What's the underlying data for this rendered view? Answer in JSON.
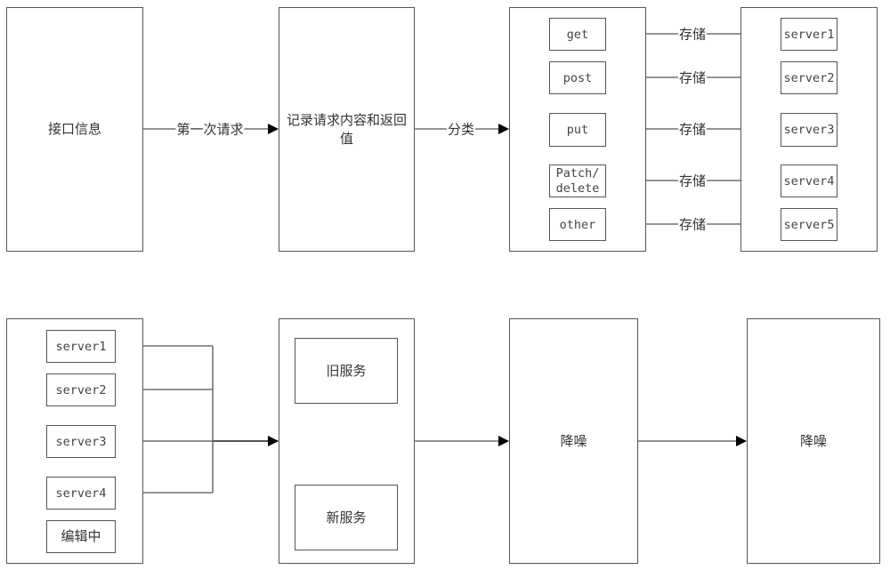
{
  "top_row": {
    "interface_info": "接口信息",
    "first_request_label": "第一次请求",
    "record_box": "记录请求内容和返回值",
    "classify_label": "分类",
    "methods": [
      "get",
      "post",
      "put",
      "Patch/\ndelete",
      "other"
    ],
    "store_label": "存储",
    "servers": [
      "server1",
      "server2",
      "server3",
      "server4",
      "server5"
    ]
  },
  "bottom_row": {
    "servers": [
      "server1",
      "server2",
      "server3",
      "server4"
    ],
    "editing": "编辑中",
    "old_service": "旧服务",
    "new_service": "新服务",
    "denoise_1": "降噪",
    "denoise_2": "降噪"
  },
  "colors": {
    "line": "#555555",
    "arrow": "#000000",
    "text": "#333333"
  }
}
